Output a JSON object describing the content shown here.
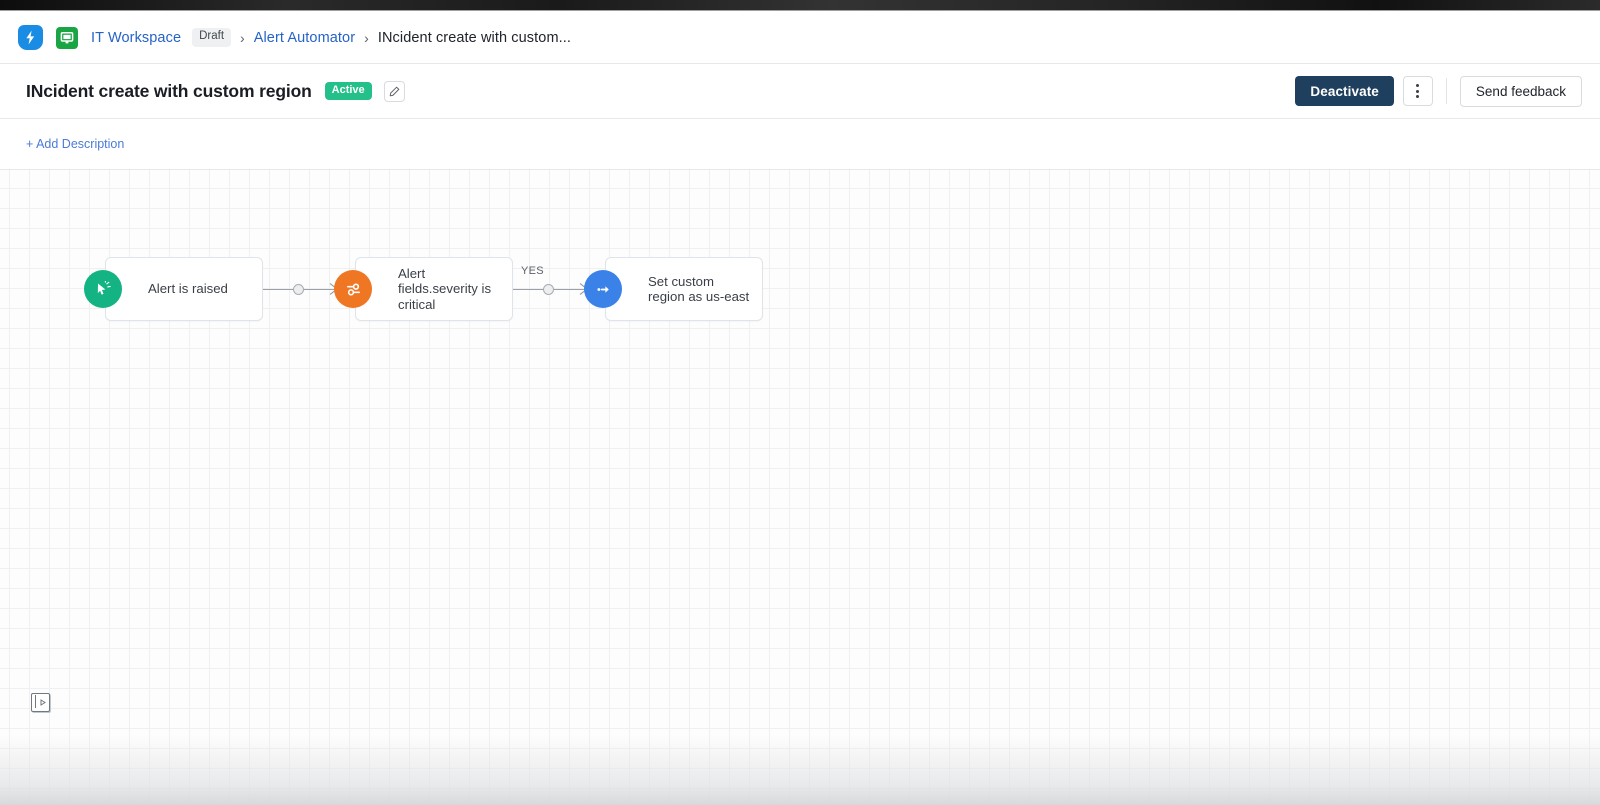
{
  "breadcrumb": {
    "logo_icon": "lightning-shield-logo",
    "app_icon": "monitor-icon",
    "workspace_label": "IT Workspace",
    "status_chip": "Draft",
    "separator": "›",
    "section_label": "Alert Automator",
    "current_label": "INcident create with custom..."
  },
  "title_bar": {
    "title": "INcident create with custom region",
    "status_badge": "Active",
    "edit_icon": "pencil-icon",
    "deactivate_label": "Deactivate",
    "more_icon": "kebab-menu-icon",
    "feedback_label": "Send feedback"
  },
  "description": {
    "add_label": "+ Add Description"
  },
  "canvas": {
    "panel_toggle_icon": "panel-collapse-icon",
    "nodes": [
      {
        "id": "trigger",
        "label": "Alert is raised",
        "icon": "cursor-click-icon",
        "color": "#13b383",
        "type": "trigger"
      },
      {
        "id": "condition",
        "label": "Alert fields.severity is critical",
        "icon": "filter-sliders-icon",
        "color": "#ef7622",
        "type": "condition"
      },
      {
        "id": "action",
        "label": "Set custom region as us-east",
        "icon": "arrow-right-circle-icon",
        "color": "#3b82e8",
        "type": "action"
      }
    ],
    "edges": [
      {
        "id": "edge-1",
        "from": "trigger",
        "to": "condition",
        "label": ""
      },
      {
        "id": "edge-2",
        "from": "condition",
        "to": "action",
        "label": "YES"
      }
    ]
  },
  "colors": {
    "link": "#2563c9",
    "primary_button": "#1f3f5e",
    "active_badge": "#24c08a",
    "trigger": "#13b383",
    "condition": "#ef7622",
    "action": "#3b82e8"
  }
}
